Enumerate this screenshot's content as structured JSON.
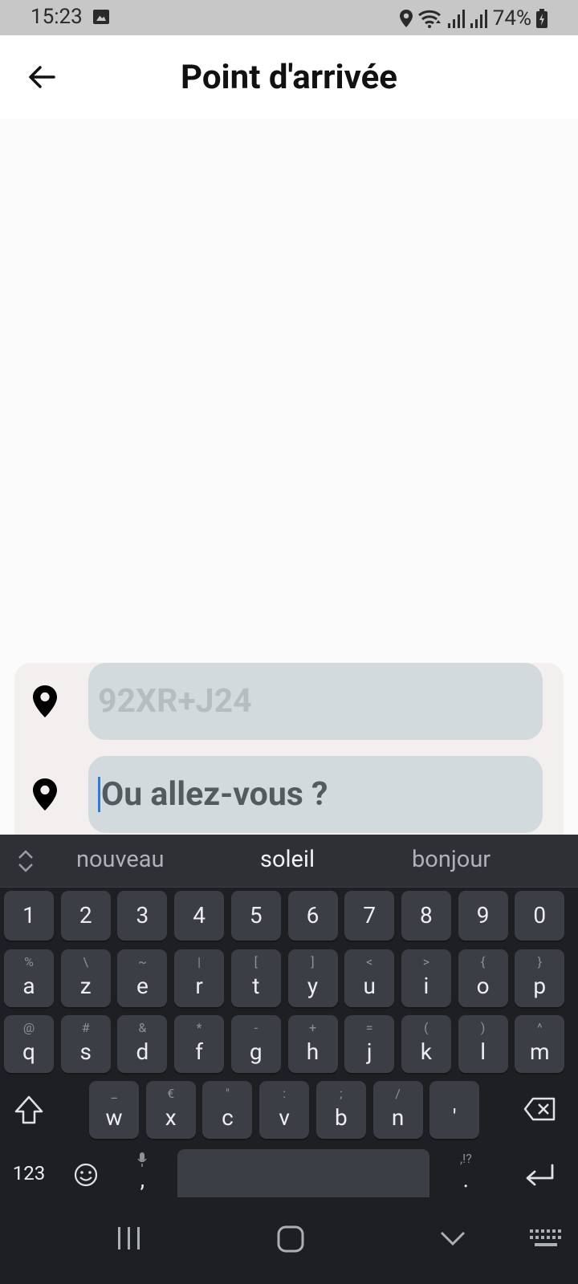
{
  "status_bar": {
    "time": "15:23",
    "battery": "74%",
    "icons": [
      "gallery-icon",
      "location-icon",
      "wifi-icon",
      "signal-icon",
      "signal-icon",
      "battery-charging-icon"
    ]
  },
  "header": {
    "title": "Point d'arrivée",
    "back_icon": "arrow-left-icon"
  },
  "route": {
    "start_placeholder": "92XR+J24",
    "destination_placeholder": "Ou allez-vous ?",
    "pin_icon": "map-pin-icon"
  },
  "keyboard": {
    "suggestions": [
      "nouveau",
      "soleil",
      "bonjour"
    ],
    "numbers": [
      "1",
      "2",
      "3",
      "4",
      "5",
      "6",
      "7",
      "8",
      "9",
      "0"
    ],
    "row1": [
      {
        "k": "a",
        "alt": "%"
      },
      {
        "k": "z",
        "alt": "\\"
      },
      {
        "k": "e",
        "alt": "~"
      },
      {
        "k": "r",
        "alt": "|"
      },
      {
        "k": "t",
        "alt": "["
      },
      {
        "k": "y",
        "alt": "]"
      },
      {
        "k": "u",
        "alt": "<"
      },
      {
        "k": "i",
        "alt": ">"
      },
      {
        "k": "o",
        "alt": "{"
      },
      {
        "k": "p",
        "alt": "}"
      }
    ],
    "row2": [
      {
        "k": "q",
        "alt": "@"
      },
      {
        "k": "s",
        "alt": "#"
      },
      {
        "k": "d",
        "alt": "&"
      },
      {
        "k": "f",
        "alt": "*"
      },
      {
        "k": "g",
        "alt": "-"
      },
      {
        "k": "h",
        "alt": "+"
      },
      {
        "k": "j",
        "alt": "="
      },
      {
        "k": "k",
        "alt": "("
      },
      {
        "k": "l",
        "alt": ")"
      },
      {
        "k": "m",
        "alt": "^"
      }
    ],
    "row3": [
      {
        "k": "w",
        "alt": "_"
      },
      {
        "k": "x",
        "alt": "€"
      },
      {
        "k": "c",
        "alt": "\""
      },
      {
        "k": "v",
        "alt": ":"
      },
      {
        "k": "b",
        "alt": ";"
      },
      {
        "k": "n",
        "alt": "/"
      },
      {
        "k": "'",
        "alt": ""
      }
    ],
    "mode_key": "123",
    "comma_key": ",",
    "period_key": ".",
    "period_alt": ",!?"
  },
  "colors": {
    "accent": "#2f7bd6",
    "field_bg": "#d2dadd",
    "keyboard_bg": "#1d1f23",
    "key_bg": "#3b3e45"
  }
}
